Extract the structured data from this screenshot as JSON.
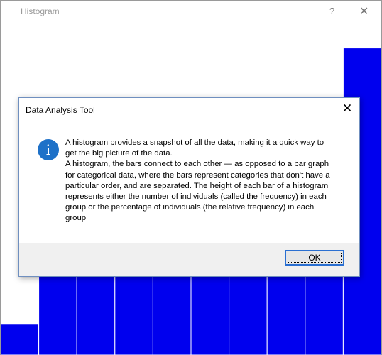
{
  "window": {
    "title": "Histogram",
    "help_glyph": "?",
    "close_glyph": "✕"
  },
  "colors": {
    "bar_fill": "#0000ee",
    "bar_edge": "#ffffff",
    "dialog_footer": "#f0f0f0",
    "info_icon": "#1e71c8"
  },
  "chart_data": {
    "type": "bar",
    "title": "",
    "xlabel": "",
    "ylabel": "",
    "bins": 10,
    "values": [
      1,
      3,
      5,
      5,
      5,
      5,
      5,
      5,
      7,
      10
    ],
    "ylim": [
      0,
      10.8
    ],
    "grid": false
  },
  "dialog": {
    "title": "Data Analysis Tool",
    "close_glyph": "✕",
    "icon": "info-icon",
    "icon_glyph": "i",
    "message": " A histogram provides a snapshot of all the data, making it a quick way to get the big picture of the data.\n A histogram, the bars connect to each other — as opposed to a bar graph for categorical data, where the bars represent categories that don't have a particular order, and are separated. The height of each bar of a histogram represents either the number of individuals (called the frequency) in each group or the percentage of individuals (the relative frequency) in each group",
    "ok_label": "OK"
  }
}
